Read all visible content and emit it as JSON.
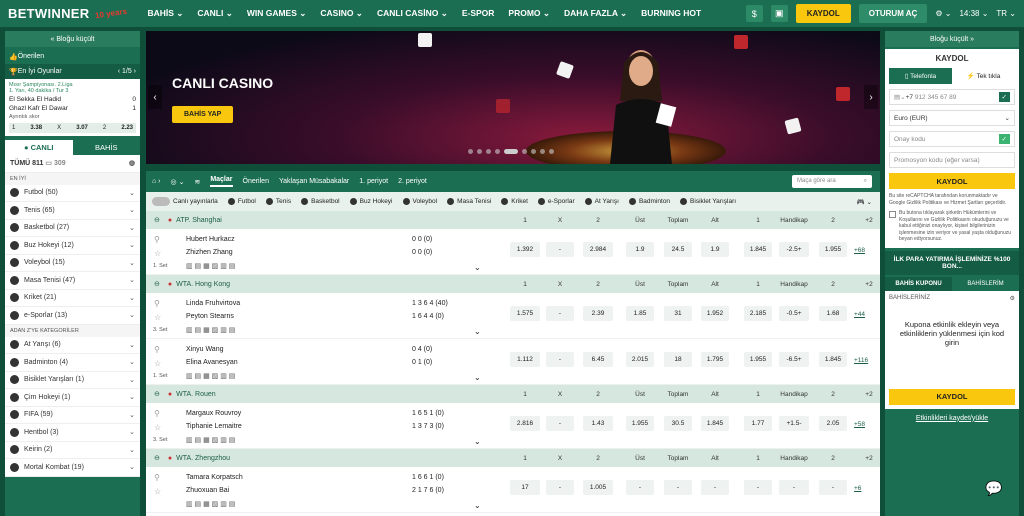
{
  "header": {
    "logo": "BETWINNER",
    "logo_badge": "10 years",
    "nav": [
      "BAHİS ⌄",
      "CANLI ⌄",
      "WIN GAMES ⌄",
      "CASINO ⌄",
      "CANLI CASİNO ⌄",
      "E-SPOR",
      "PROMO ⌄",
      "DAHA FAZLA ⌄",
      "BURNING HOT"
    ],
    "register": "KAYDOL",
    "login": "OTURUM AÇ",
    "time": "14:38 ⌄",
    "lang": "TR ⌄"
  },
  "left": {
    "collapse": "« Bloğu küçült",
    "featured": "Önerilen",
    "top_games": "En İyi Oyunlar",
    "pager": "1/5",
    "match_league": "Mısır Şampiyonası. 2.Liga",
    "match_meta": "1. Yarı, 40 dakika / Tur 3",
    "team1": "El Sekka El Hadid",
    "team2": "Ghazl Kafr El Dawar",
    "score1": "0",
    "score2": "1",
    "more": "Ayrıntılı skor",
    "odds": [
      "1",
      "3.38",
      "X",
      "3.07",
      "2",
      "2.23"
    ],
    "tab_live": "● CANLI",
    "tab_bets": "BAHİS",
    "all_label": "TÜMÜ 811",
    "all_count": "309",
    "best_label": "EN İYİ",
    "sports": [
      {
        "n": "Futbol (50)"
      },
      {
        "n": "Tenis (65)"
      },
      {
        "n": "Basketbol (27)"
      },
      {
        "n": "Buz Hokeyi (12)"
      },
      {
        "n": "Voleybol (15)"
      },
      {
        "n": "Masa Tenisi (47)"
      },
      {
        "n": "Kriket (21)"
      },
      {
        "n": "e-Sporlar (13)"
      }
    ],
    "cat_label": "ADAN Z'YE KATEGORİLER",
    "cats": [
      {
        "n": "At Yarışı (6)"
      },
      {
        "n": "Badminton (4)"
      },
      {
        "n": "Bisiklet Yarışları (1)"
      },
      {
        "n": "Çim Hokeyi (1)"
      },
      {
        "n": "FIFA (59)"
      },
      {
        "n": "Hentbol (3)"
      },
      {
        "n": "Keirin (2)"
      },
      {
        "n": "Mortal Kombat (19)"
      }
    ]
  },
  "banner": {
    "title": "CANLI CASINO",
    "button": "BAHİS YAP"
  },
  "center": {
    "tabs": [
      "Maçlar",
      "Önerilen",
      "Yaklaşan Müsabakalar",
      "1. periyot",
      "2. periyot"
    ],
    "search": "Maça göre ara",
    "live_stream": "Canlı yayınlarla",
    "filters": [
      "Futbol",
      "Tenis",
      "Basketbol",
      "Buz Hokeyi",
      "Voleybol",
      "Masa Tenisi",
      "Kriket",
      "e-Sporlar",
      "At Yarışı",
      "Badminton",
      "Bisiklet Yarışları"
    ],
    "cols": [
      "1",
      "X",
      "2",
      "Üst",
      "Toplam",
      "Alt",
      "1",
      "Handikap",
      "2",
      "+2"
    ],
    "leagues": [
      {
        "name": "ATP. Shanghai",
        "matches": [
          {
            "t1": "Hubert Hurkacz",
            "t2": "Zhizhen Zhang",
            "s1": "0  0  (0)",
            "s2": "0  0  (0)",
            "set": "1. Set",
            "odds": [
              "1.392",
              "-",
              "2.984",
              "1.9",
              "24.5",
              "1.9",
              "1.845",
              "-2.5+",
              "1.955"
            ],
            "more": "+68"
          }
        ]
      },
      {
        "name": "WTA. Hong Kong",
        "matches": [
          {
            "t1": "Linda Fruhvirtova",
            "t2": "Peyton Stearns",
            "s1": "1  3  6  4  (40)",
            "s2": "1  6  4  4  (0)",
            "set": "3. Set",
            "odds": [
              "1.575",
              "-",
              "2.39",
              "1.85",
              "31",
              "1.952",
              "2.185",
              "-0.5+",
              "1.68"
            ],
            "more": "+44"
          },
          {
            "t1": "Xinyu Wang",
            "t2": "Elina Avanesyan",
            "s1": "0  4  (0)",
            "s2": "0  1  (0)",
            "set": "1. Set",
            "odds": [
              "1.112",
              "-",
              "6.45",
              "2.015",
              "18",
              "1.795",
              "1.955",
              "-6.5+",
              "1.845"
            ],
            "more": "+116"
          }
        ]
      },
      {
        "name": "WTA. Rouen",
        "matches": [
          {
            "t1": "Margaux Rouvroy",
            "t2": "Tiphanie Lemaitre",
            "s1": "1  6  5  1  (0)",
            "s2": "1  3  7  3  (0)",
            "set": "3. Set",
            "odds": [
              "2.816",
              "-",
              "1.43",
              "1.955",
              "30.5",
              "1.845",
              "1.77",
              "+1.5-",
              "2.05"
            ],
            "more": "+58"
          }
        ]
      },
      {
        "name": "WTA. Zhengzhou",
        "matches": [
          {
            "t1": "Tamara Korpatsch",
            "t2": "Zhuoxuan Bai",
            "s1": "1  6  6  1  (0)",
            "s2": "2  1  7  6  (0)",
            "set": "",
            "odds": [
              "17",
              "-",
              "1.005",
              "-",
              "-",
              "-",
              "-",
              "-",
              "-"
            ],
            "more": "+6"
          }
        ]
      }
    ]
  },
  "right": {
    "collapse": "Bloğu küçült »",
    "reg_title": "KAYDOL",
    "tab_phone": "Telefonla",
    "tab_click": "Tek tıkla",
    "phone_prefix": "+7",
    "phone_placeholder": "912 345 67 89",
    "currency": "Euro (EUR)",
    "code": "Onay kodu",
    "promo_code": "Promosyon kodu (eğer varsa)",
    "register": "KAYDOL",
    "recaptcha": "Bu site reCAPTCHA tarafından korunmaktadır ve Google Gizlilik Politikası ve Hizmet Şartları geçerlidir.",
    "terms": "Bu butona tıklayarak şirketin Hükümlerini ve Koşullarını ve Gizlilik Politikasını okuduğunuzu ve kabul ettiğinizi onaylıyor, kişisel bilgilerinizin işlenmesine izin veriyor ve yasal yaşta olduğunuzu beyan ediyorsunuz.",
    "promo": "İLK PARA YATIRMA İŞLEMİNİZE %100 BON...",
    "kupon": "BAHİS KUPONU",
    "my_bets": "BAHİSLERİM",
    "bets_label": "BAHİSLERİNİZ",
    "empty": "Kupona etkinlik ekleyin veya etkinliklerin yüklenmesi için kod girin",
    "kupon_btn": "KAYDOL",
    "save": "Etkinlikleri kaydet/yükle"
  }
}
